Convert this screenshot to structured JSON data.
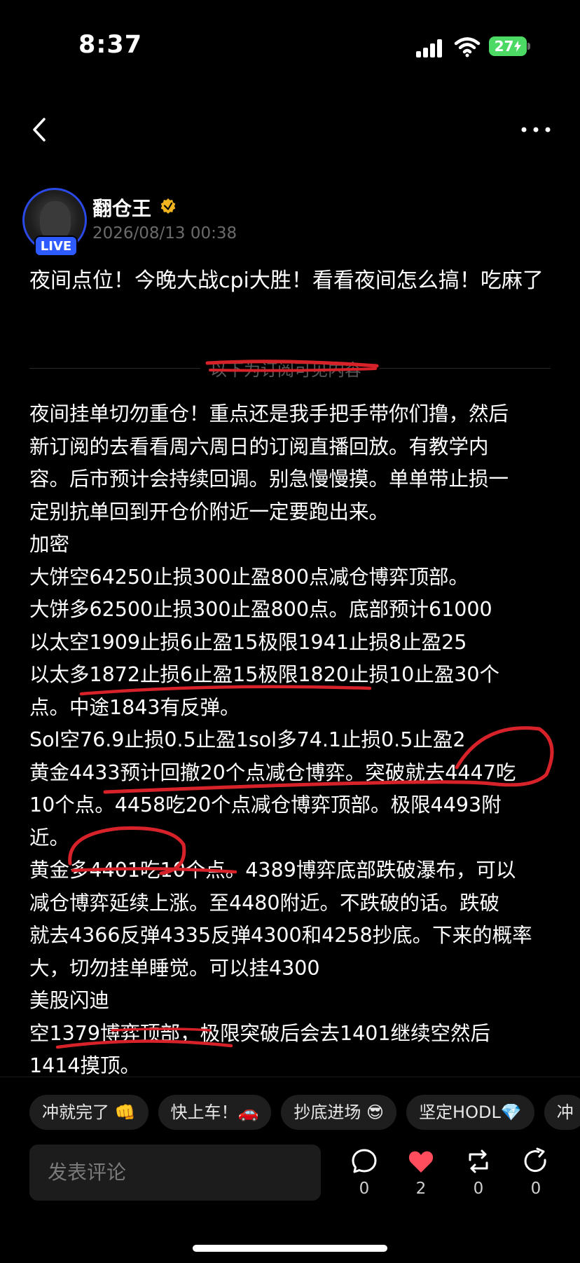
{
  "status_bar": {
    "time": "8:37",
    "battery": "27"
  },
  "author": {
    "name": "翻仓王",
    "live_label": "LIVE",
    "timestamp": "2026/08/13 00:38"
  },
  "post": {
    "title": "夜间点位！今晚大战cpi大胜！看看夜间怎么搞！吃麻了",
    "divider_text": "以下为订阅可见内容",
    "lines": [
      "夜间挂单切勿重仓！重点还是我手把手带你们撸，然后",
      "新订阅的去看看周六周日的订阅直播回放。有教学内",
      "容。后市预计会持续回调。别急慢慢摸。单单带止损一",
      "定别抗单回到开仓价附近一定要跑出来。",
      "加密",
      "大饼空64250止损300止盈800点减仓博弈顶部。",
      "大饼多62500止损300止盈800点。底部预计61000",
      "以太空1909止损6止盈15极限1941止损8止盈25",
      "以太多1872止损6止盈15极限1820止损10止盈30个",
      "点。中途1843有反弹。",
      "Sol空76.9止损0.5止盈1sol多74.1止损0.5止盈2",
      "黄金4433预计回撤20个点减仓博弈。突破就去4447吃",
      "10个点。4458吃20个点减仓博弈顶部。极限4493附",
      "近。",
      "黄金多4401吃10个点。4389博弈底部跌破瀑布，可以",
      "减仓博弈延续上涨。至4480附近。不跌破的话。跌破",
      "就去4366反弹4335反弹4300和4258抄底。下来的概率",
      "大，切勿挂单睡觉。可以挂4300",
      "美股闪迪",
      "空1379博弈顶部，极限突破后会去1401继续空然后",
      "1414摸顶。"
    ]
  },
  "quick_replies": [
    "冲就完了 👊",
    "快上车！🚗",
    "抄底进场 😎",
    "坚定HODL💎",
    "冲"
  ],
  "comment": {
    "placeholder": "发表评论"
  },
  "actions": {
    "comment_count": "0",
    "like_count": "2",
    "repost_count": "0",
    "share_count": "0"
  },
  "colors": {
    "background": "#000000",
    "live_badge": "#2d5bff",
    "like": "#ff4d5e",
    "annotation": "#d8222a"
  }
}
